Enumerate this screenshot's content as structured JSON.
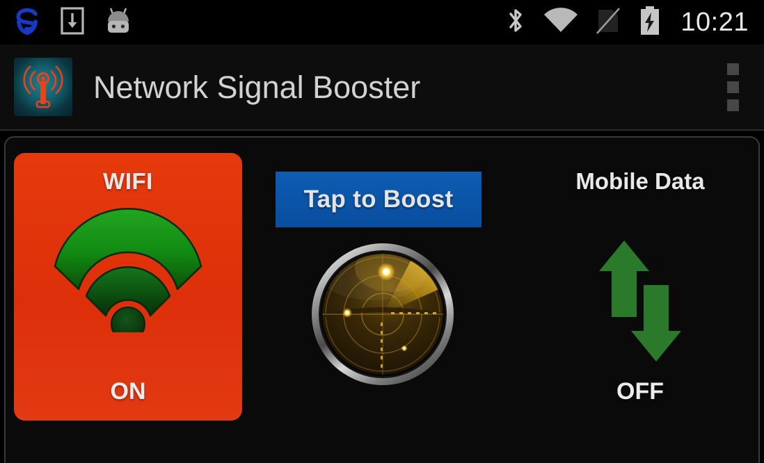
{
  "statusbar": {
    "time": "10:21",
    "left_icons": [
      {
        "name": "sophos-security-icon",
        "label": "S"
      },
      {
        "name": "download-icon",
        "label": "download"
      },
      {
        "name": "android-system-icon",
        "label": "android"
      }
    ],
    "right_icons": [
      {
        "name": "bluetooth-icon",
        "label": "bluetooth"
      },
      {
        "name": "wifi-signal-icon",
        "label": "wifi full"
      },
      {
        "name": "no-sim-icon",
        "label": "no sim"
      },
      {
        "name": "battery-charging-icon",
        "label": "battery charging"
      }
    ]
  },
  "actionbar": {
    "app_icon_name": "network-signal-booster-app-icon",
    "title": "Network Signal Booster",
    "overflow_label": "More options"
  },
  "main": {
    "wifi": {
      "title": "WIFI",
      "state": "ON",
      "card_color": "#dd2f0a",
      "glyph_color": "#1a9a1a"
    },
    "boost": {
      "button_label": "Tap to Boost",
      "button_color": "#0b55a9",
      "radar_name": "radar-dial"
    },
    "mobile_data": {
      "title": "Mobile Data",
      "state": "OFF",
      "glyph_color": "#2b7a2b"
    }
  }
}
